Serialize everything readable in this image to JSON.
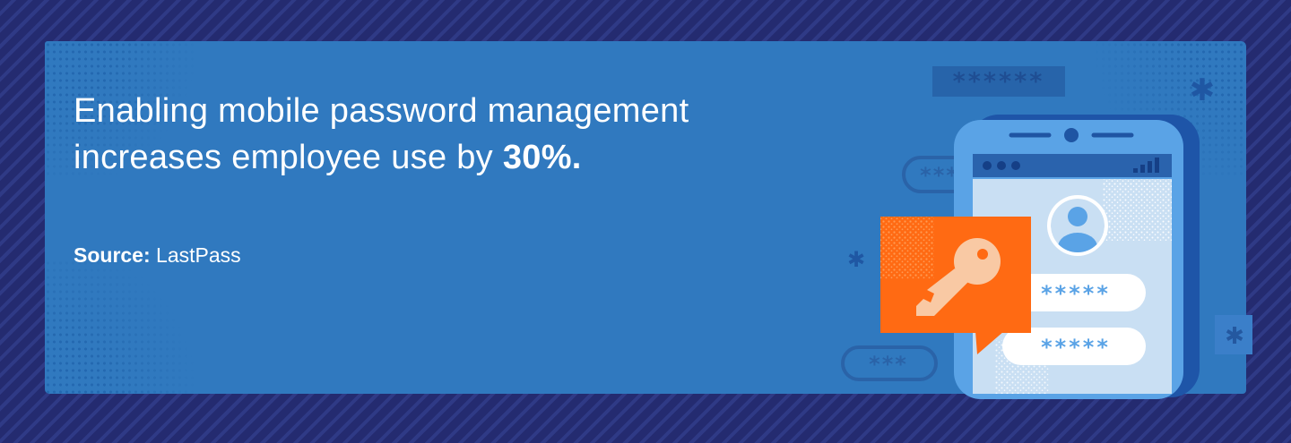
{
  "headline": {
    "line1": "Enabling mobile password management",
    "line2_prefix": "increases employee use by ",
    "line2_highlight": "30%."
  },
  "source": {
    "label": "Source:",
    "value": "LastPass"
  },
  "colors": {
    "background": "#22286a",
    "panel": "#3079bf",
    "text": "#ffffff",
    "key_bubble": "#ff6a13",
    "phone_frame": "#5aa3e6",
    "phone_screen": "#c9dff3"
  },
  "illustration": {
    "password_masks": [
      "******",
      "***",
      "*****",
      "*****",
      "***"
    ],
    "icons": [
      "phone-icon",
      "key-icon",
      "user-avatar-icon",
      "signal-icon",
      "asterisk-icon"
    ]
  }
}
